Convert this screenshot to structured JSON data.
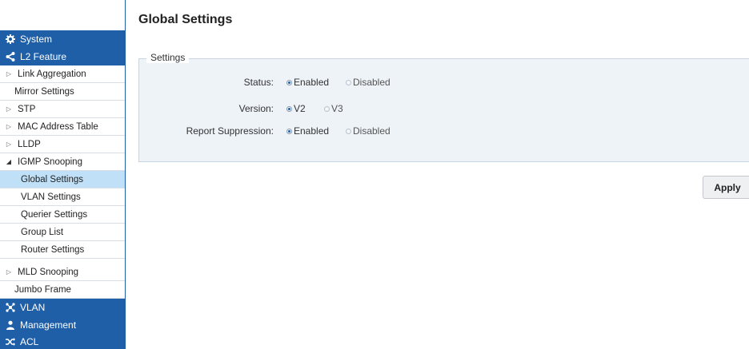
{
  "page_title": "Global Settings",
  "settings": {
    "legend": "Settings",
    "rows": [
      {
        "label": "Status:",
        "options": [
          {
            "label": "Enabled",
            "selected": true
          },
          {
            "label": "Disabled",
            "selected": false
          }
        ]
      },
      {
        "label": "Version:",
        "options": [
          {
            "label": "V2",
            "selected": true
          },
          {
            "label": "V3",
            "selected": false
          }
        ]
      },
      {
        "label": "Report Suppression:",
        "options": [
          {
            "label": "Enabled",
            "selected": true
          },
          {
            "label": "Disabled",
            "selected": false
          }
        ]
      }
    ]
  },
  "apply_label": "Apply",
  "sidebar": {
    "sections": [
      {
        "label": "System",
        "icon": "gear-icon"
      },
      {
        "label": "L2 Feature",
        "icon": "share-icon"
      },
      {
        "label": "VLAN",
        "icon": "network-icon"
      },
      {
        "label": "Management",
        "icon": "user-icon"
      },
      {
        "label": "ACL",
        "icon": "shuffle-icon"
      }
    ],
    "items": [
      {
        "label": "Link Aggregation"
      },
      {
        "label": "Mirror Settings"
      },
      {
        "label": "STP"
      },
      {
        "label": "MAC Address Table"
      },
      {
        "label": "LLDP"
      },
      {
        "label": "IGMP Snooping",
        "expanded": true
      },
      {
        "label": "Global Settings",
        "active": true
      },
      {
        "label": "VLAN Settings"
      },
      {
        "label": "Querier Settings"
      },
      {
        "label": "Group List"
      },
      {
        "label": "Router Settings"
      },
      {
        "label": "MLD Snooping"
      },
      {
        "label": "Jumbo Frame"
      }
    ]
  },
  "colors": {
    "nav_header": "#1f5fa8",
    "active_item": "#bfe0f7",
    "panel": "#eef3f8"
  }
}
